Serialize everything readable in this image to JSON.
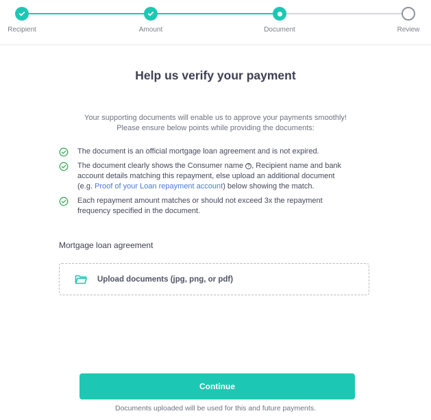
{
  "stepper": {
    "steps": [
      {
        "label": "Recipient",
        "state": "done"
      },
      {
        "label": "Amount",
        "state": "done"
      },
      {
        "label": "Document",
        "state": "current"
      },
      {
        "label": "Review",
        "state": "todo"
      }
    ]
  },
  "page": {
    "title": "Help us verify your payment",
    "intro_line1": "Your supporting documents will enable us to approve your payments smoothly!",
    "intro_line2": "Please ensure below points while providing the documents:"
  },
  "points": {
    "p1": "The document is an official mortgage loan agreement and is not expired.",
    "p2_before": "The document clearly shows the Consumer name",
    "p2_after_icon": ", Recipient name and bank account details matching this repayment, else upload an additional document (e.g. ",
    "p2_link": "Proof of your Loan repayment account",
    "p2_end": ") below showing the match.",
    "p3": "Each repayment amount matches or should not exceed 3x the repayment frequency specified in the document."
  },
  "upload_section": {
    "label": "Mortgage loan agreement",
    "button_text": "Upload documents (jpg, png, or pdf)"
  },
  "footer": {
    "continue_label": "Continue",
    "note": "Documents uploaded will be used for this and future payments."
  },
  "icons": {
    "step_done": "check-icon",
    "check": "check-circle-icon",
    "help": "question-circle-icon",
    "upload": "folder-icon"
  },
  "colors": {
    "accent": "#1cc8b4",
    "link": "#4a78d6",
    "check": "#3fae5a"
  }
}
